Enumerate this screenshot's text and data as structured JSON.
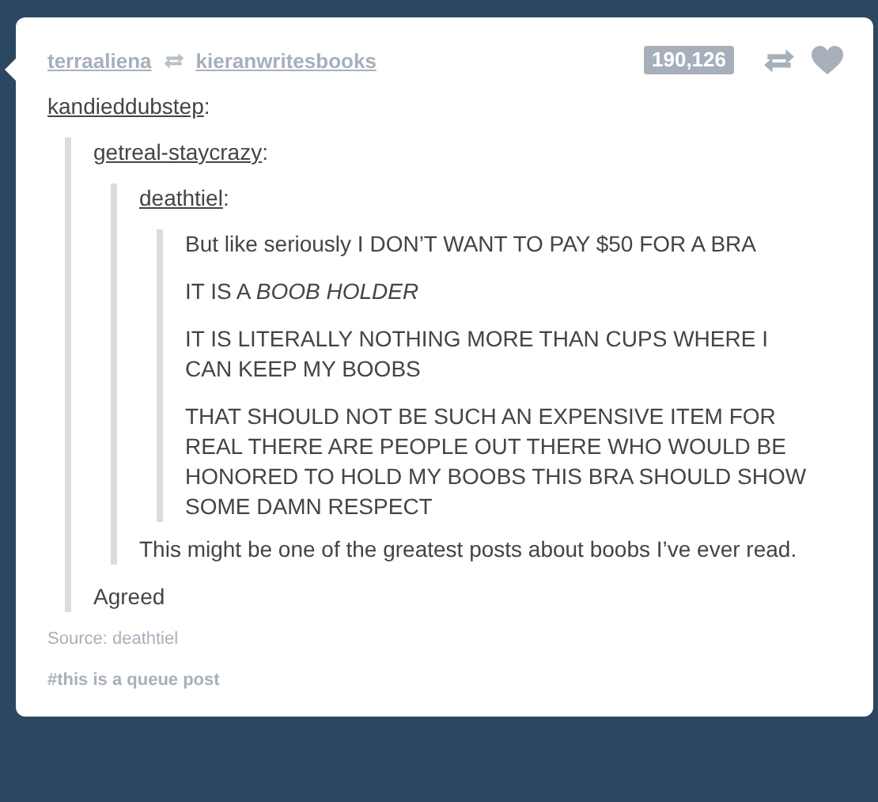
{
  "header": {
    "reblogged_by": "terraaliena",
    "reblogged_from": "kieranwritesbooks",
    "note_count": "190,126"
  },
  "thread": {
    "author": "kandieddubstep",
    "separator": ":",
    "quote": {
      "author": "getreal-staycrazy",
      "separator": ":",
      "quote": {
        "author": "deathtiel",
        "separator": ":",
        "paragraphs": [
          "But like seriously I DON’T WANT TO PAY $50 FOR A BRA",
          "IT IS A *BOOB HOLDER*",
          "IT IS LITERALLY NOTHING MORE THAN CUPS WHERE I CAN KEEP MY BOOBS",
          "THAT SHOULD NOT BE SUCH AN EXPENSIVE ITEM FOR REAL THERE ARE PEOPLE OUT THERE WHO WOULD BE HONORED TO HOLD MY BOOBS THIS BRA SHOULD SHOW SOME DAMN RESPECT"
        ],
        "replies": [
          "This might be one of the greatest posts about boobs I’ve ever read."
        ]
      },
      "replies": [
        "Agreed"
      ]
    }
  },
  "source": "Source: deathtiel",
  "tags": [
    "#this is a queue post"
  ]
}
